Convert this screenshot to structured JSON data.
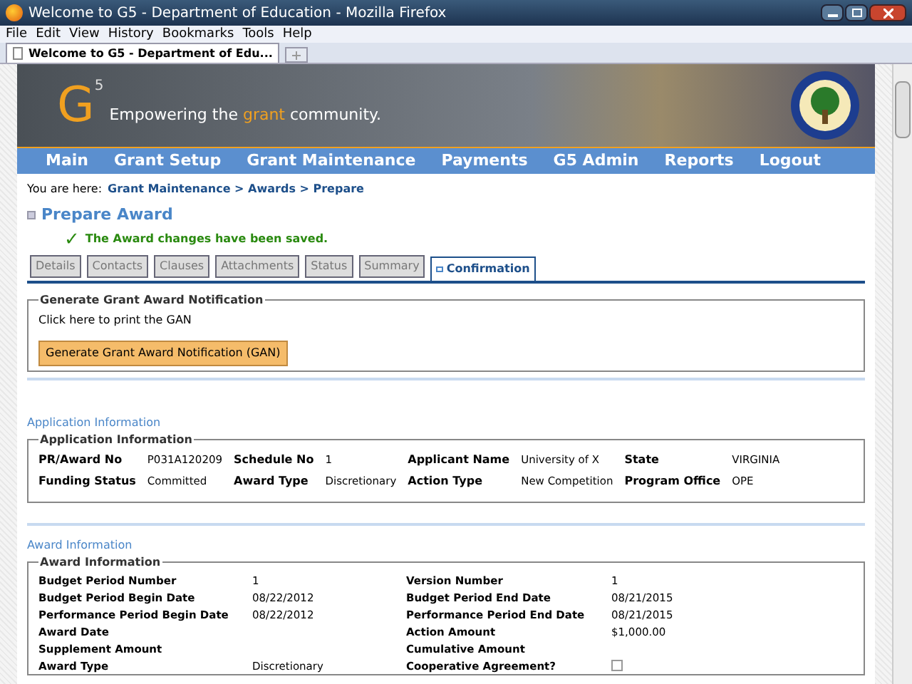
{
  "window": {
    "title": "Welcome to G5 - Department of Education - Mozilla Firefox"
  },
  "menu_bar": [
    "File",
    "Edit",
    "View",
    "History",
    "Bookmarks",
    "Tools",
    "Help"
  ],
  "browser_tabs": [
    {
      "label": "Welcome to G5 - Department of Edu...",
      "selected": true
    }
  ],
  "banner": {
    "logo_letter": "G",
    "logo_superscript": "5",
    "tagline_before": "Empowering the ",
    "tagline_highlight": "grant",
    "tagline_after": " community."
  },
  "nav": [
    "Main",
    "Grant Setup",
    "Grant Maintenance",
    "Payments",
    "G5 Admin",
    "Reports",
    "Logout"
  ],
  "breadcrumb": {
    "prefix": "You are here:",
    "path": "Grant Maintenance > Awards > Prepare"
  },
  "page_title": "Prepare Award",
  "success_icon": "✓",
  "success_message": "The Award changes have been saved.",
  "tabs": [
    {
      "label": "Details",
      "selected": false
    },
    {
      "label": "Contacts",
      "selected": false
    },
    {
      "label": "Clauses",
      "selected": false
    },
    {
      "label": "Attachments",
      "selected": false
    },
    {
      "label": "Status",
      "selected": false
    },
    {
      "label": "Summary",
      "selected": false
    },
    {
      "label": "Confirmation",
      "selected": true
    }
  ],
  "gan_section": {
    "legend": "Generate Grant Award Notification",
    "text": "Click here to print the GAN",
    "button": "Generate Grant Award Notification (GAN)"
  },
  "application_info": {
    "link": "Application Information",
    "legend": "Application Information",
    "rows": [
      [
        {
          "label": "PR/Award No",
          "value": "P031A120209"
        },
        {
          "label": "Schedule No",
          "value": "1"
        },
        {
          "label": "Applicant Name",
          "value": "University of X"
        },
        {
          "label": "State",
          "value": "VIRGINIA"
        }
      ],
      [
        {
          "label": "Funding Status",
          "value": "Committed"
        },
        {
          "label": "Award Type",
          "value": "Discretionary"
        },
        {
          "label": "Action Type",
          "value": "New Competition"
        },
        {
          "label": "Program Office",
          "value": "OPE"
        }
      ]
    ]
  },
  "award_info": {
    "link": "Award Information",
    "legend": "Award Information",
    "fields": [
      {
        "kind": "text",
        "label": "Budget Period Number",
        "value": "1"
      },
      {
        "kind": "text",
        "label": "Version Number",
        "value": "1"
      },
      {
        "kind": "text",
        "label": "Budget Period Begin Date",
        "value": "08/22/2012"
      },
      {
        "kind": "text",
        "label": "Budget Period End Date",
        "value": "08/21/2015"
      },
      {
        "kind": "text",
        "label": "Performance Period Begin Date",
        "value": "08/22/2012"
      },
      {
        "kind": "text",
        "label": "Performance Period End Date",
        "value": "08/21/2015"
      },
      {
        "kind": "text",
        "label": "Award Date"
      },
      {
        "kind": "text",
        "label": "Action Amount",
        "value": "$1,000.00"
      },
      {
        "kind": "text",
        "label": "Supplement Amount"
      },
      {
        "kind": "text",
        "label": "Cumulative Amount"
      },
      {
        "kind": "text",
        "label": "Award Type",
        "value": "Discretionary"
      },
      {
        "kind": "checkbox",
        "label": "Cooperative Agreement?",
        "checked": false
      }
    ]
  }
}
